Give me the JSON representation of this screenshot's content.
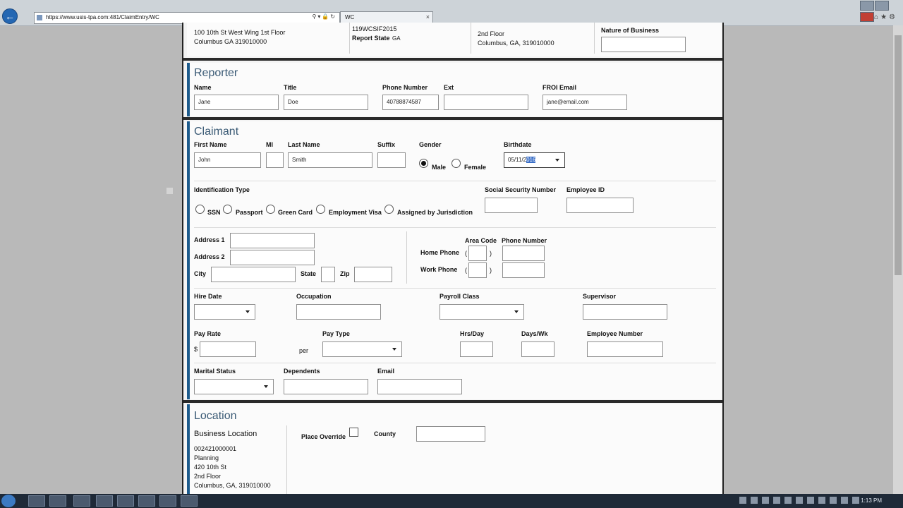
{
  "browser": {
    "url": "https://www.usis-tpa.com:481/ClaimEntry/WC",
    "tab_title": "WC",
    "tab_close": "×",
    "back": "←"
  },
  "top": {
    "address_line1": "100 10th St West Wing 1st Floor",
    "address_line2": "Columbus GA 319010000",
    "report_id": "119WCSIF2015",
    "report_state_label": "Report State",
    "report_state_value": "GA",
    "addr2_line1": "2nd Floor",
    "addr2_line2": "Columbus, GA, 319010000",
    "nature_of_business_label": "Nature of Business"
  },
  "reporter": {
    "heading": "Reporter",
    "labels": {
      "name": "Name",
      "title": "Title",
      "phone": "Phone Number",
      "ext": "Ext",
      "email": "FROI Email"
    },
    "values": {
      "name": "Jane",
      "title": "Doe",
      "phone": "40788874587",
      "ext": "",
      "email": "jane@email.com"
    }
  },
  "claimant": {
    "heading": "Claimant",
    "labels": {
      "first_name": "First Name",
      "mi": "MI",
      "last_name": "Last Name",
      "suffix": "Suffix",
      "gender": "Gender",
      "birthdate": "Birthdate",
      "id_type": "Identification Type",
      "ssn_label": "Social Security Number",
      "employee_id": "Employee ID",
      "address1": "Address 1",
      "address2": "Address 2",
      "city": "City",
      "state": "State",
      "zip": "Zip",
      "area_code": "Area Code",
      "phone_number": "Phone Number",
      "home_phone": "Home Phone",
      "work_phone": "Work Phone",
      "hire_date": "Hire Date",
      "occupation": "Occupation",
      "payroll_class": "Payroll Class",
      "supervisor": "Supervisor",
      "pay_rate": "Pay Rate",
      "dollar": "$",
      "per": "per",
      "pay_type": "Pay Type",
      "hrs_day": "Hrs/Day",
      "days_wk": "Days/Wk",
      "employee_number": "Employee Number",
      "marital_status": "Marital Status",
      "dependents": "Dependents",
      "email": "Email",
      "paren_open": "(",
      "paren_close": ")"
    },
    "values": {
      "first_name": "John",
      "last_name": "Smith",
      "birthdate_pre": "05/11/2",
      "birthdate_sel": "016"
    },
    "gender_options": {
      "male": "Male",
      "female": "Female",
      "selected": "male"
    },
    "id_types": {
      "ssn": "SSN",
      "passport": "Passport",
      "green_card": "Green Card",
      "employment_visa": "Employment Visa",
      "jurisdiction": "Assigned by Jurisdiction"
    }
  },
  "location": {
    "heading": "Location",
    "business_location_label": "Business Location",
    "place_override_label": "Place Override",
    "county_label": "County",
    "address_lines": [
      "002421000001",
      "Planning",
      "420 10th St",
      "2nd Floor",
      "Columbus, GA, 319010000"
    ]
  },
  "taskbar": {
    "clock": "1:13 PM"
  },
  "colors": {
    "section_bar": "#1d5b8c",
    "heading": "#3a5a75"
  }
}
